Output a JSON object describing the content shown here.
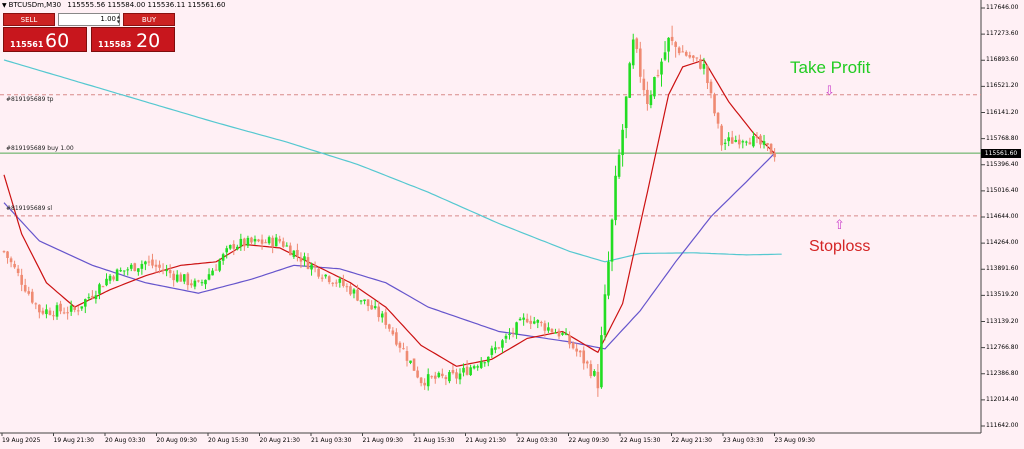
{
  "header": {
    "symbol": "BTCUSDm,M30",
    "ohlc": "115555.56 115584.00 115536.11 115561.60"
  },
  "order_panel": {
    "sell_label": "SELL",
    "buy_label": "BUY",
    "lot_value": "1.00",
    "sell_price_small": "115561",
    "sell_price_big": "60",
    "buy_price_small": "115583",
    "buy_price_big": "20"
  },
  "lines": {
    "tp_label": "#819195689 tp",
    "buy_label": "#819195689 buy 1.00",
    "sl_label": "#819195689 sl"
  },
  "annotations": {
    "take_profit": "Take Profit",
    "stoploss": "Stoploss",
    "tp_arrow": "⇩",
    "sl_arrow": "⇧"
  },
  "price_axis": {
    "labels": [
      "117646.00",
      "117273.60",
      "116893.60",
      "116521.20",
      "116141.20",
      "115768.80",
      "115396.40",
      "115016.40",
      "114644.00",
      "114264.00",
      "113891.60",
      "113519.20",
      "113139.20",
      "112766.80",
      "112386.80",
      "112014.40",
      "111642.00"
    ],
    "current_price": "115561.60"
  },
  "time_axis": {
    "labels": [
      "19 Aug 2025",
      "19 Aug 21:30",
      "20 Aug 03:30",
      "20 Aug 09:30",
      "20 Aug 15:30",
      "20 Aug 21:30",
      "21 Aug 03:30",
      "21 Aug 09:30",
      "21 Aug 15:30",
      "21 Aug 21:30",
      "22 Aug 03:30",
      "22 Aug 09:30",
      "22 Aug 15:30",
      "22 Aug 21:30",
      "23 Aug 03:30",
      "23 Aug 09:30"
    ]
  },
  "colors": {
    "background": "#fff0f5",
    "bull_candle": "#22dd22",
    "bear_candle": "#ef8a72",
    "ma_fast": "#cc1111",
    "ma_mid": "#6655cc",
    "ma_slow": "#55c8d0",
    "tp_sl_line": "#d88a8a",
    "order_line": "#55aa55"
  },
  "chart_data": {
    "type": "candlestick",
    "symbol": "BTCUSDm",
    "timeframe": "M30",
    "ylim": [
      111642.0,
      117646.0
    ],
    "levels": {
      "tp": 116400,
      "entry": 115561.6,
      "sl": 114660
    },
    "close_anchors": [
      [
        0,
        114150
      ],
      [
        10,
        113300
      ],
      [
        20,
        113300
      ],
      [
        30,
        113800
      ],
      [
        40,
        114000
      ],
      [
        55,
        113650
      ],
      [
        65,
        114250
      ],
      [
        78,
        114300
      ],
      [
        88,
        113900
      ],
      [
        98,
        113600
      ],
      [
        108,
        113150
      ],
      [
        118,
        112300
      ],
      [
        128,
        112350
      ],
      [
        138,
        112700
      ],
      [
        148,
        113200
      ],
      [
        158,
        112950
      ],
      [
        163,
        112650
      ],
      [
        168,
        112300
      ],
      [
        173,
        115100
      ],
      [
        178,
        117100
      ],
      [
        182,
        116350
      ],
      [
        188,
        117150
      ],
      [
        198,
        116800
      ],
      [
        203,
        115700
      ],
      [
        210,
        115800
      ],
      [
        218,
        115560
      ]
    ],
    "ma_fast": [
      [
        0,
        115250
      ],
      [
        5,
        114400
      ],
      [
        12,
        113700
      ],
      [
        20,
        113350
      ],
      [
        30,
        113600
      ],
      [
        40,
        113800
      ],
      [
        50,
        113950
      ],
      [
        60,
        114000
      ],
      [
        68,
        114250
      ],
      [
        78,
        114200
      ],
      [
        88,
        113950
      ],
      [
        98,
        113700
      ],
      [
        108,
        113350
      ],
      [
        118,
        112800
      ],
      [
        128,
        112500
      ],
      [
        138,
        112600
      ],
      [
        148,
        112900
      ],
      [
        158,
        113000
      ],
      [
        168,
        112700
      ],
      [
        175,
        113400
      ],
      [
        182,
        115000
      ],
      [
        188,
        116400
      ],
      [
        192,
        116800
      ],
      [
        198,
        116900
      ],
      [
        205,
        116300
      ],
      [
        212,
        115850
      ],
      [
        218,
        115560
      ]
    ],
    "ma_mid": [
      [
        0,
        114850
      ],
      [
        10,
        114300
      ],
      [
        25,
        113950
      ],
      [
        40,
        113700
      ],
      [
        55,
        113550
      ],
      [
        70,
        113750
      ],
      [
        82,
        113950
      ],
      [
        95,
        113900
      ],
      [
        108,
        113700
      ],
      [
        120,
        113350
      ],
      [
        140,
        113000
      ],
      [
        160,
        112850
      ],
      [
        170,
        112750
      ],
      [
        180,
        113300
      ],
      [
        190,
        114000
      ],
      [
        200,
        114650
      ],
      [
        210,
        115150
      ],
      [
        218,
        115560
      ]
    ],
    "ma_slow": [
      [
        0,
        116900
      ],
      [
        20,
        116600
      ],
      [
        40,
        116300
      ],
      [
        60,
        116000
      ],
      [
        80,
        115720
      ],
      [
        100,
        115400
      ],
      [
        120,
        115000
      ],
      [
        140,
        114550
      ],
      [
        160,
        114150
      ],
      [
        170,
        114000
      ],
      [
        180,
        114120
      ],
      [
        195,
        114130
      ],
      [
        210,
        114100
      ],
      [
        220,
        114110
      ]
    ]
  }
}
